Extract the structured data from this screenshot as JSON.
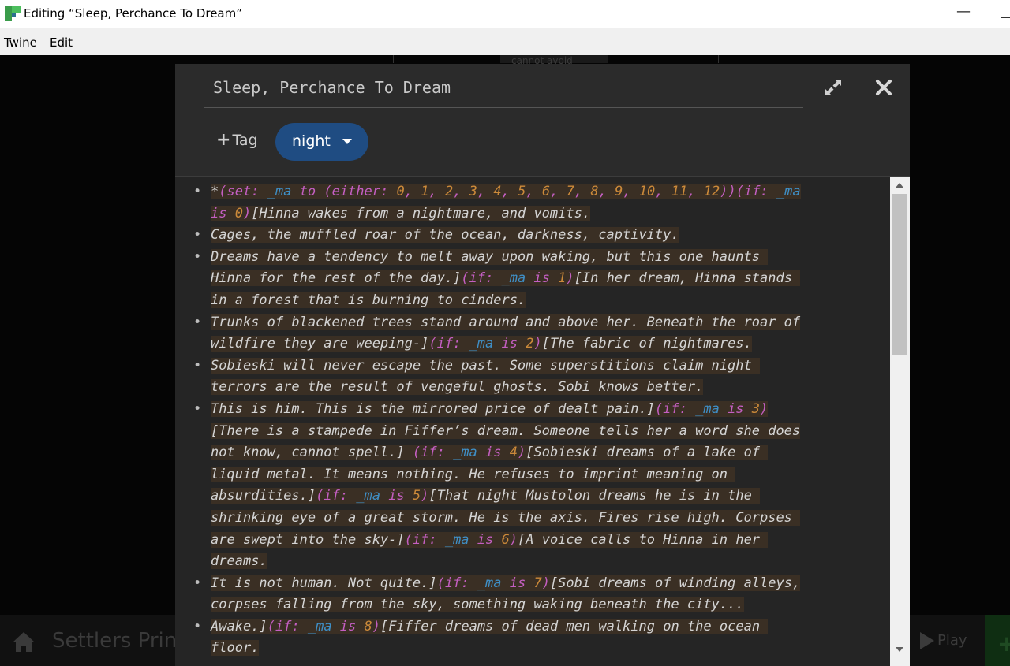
{
  "window": {
    "title": "Editing “Sleep, Perchance To Dream”",
    "menu": [
      "Twine",
      "Edit"
    ]
  },
  "background": {
    "map_label": "cannot avoid",
    "story_name": "Settlers Prin",
    "play_label": "Play"
  },
  "dialog": {
    "passage_name": "Sleep, Perchance To Dream",
    "tag_button_label": "Tag",
    "tags": [
      {
        "name": "night"
      }
    ]
  },
  "editor": {
    "lines": [
      {
        "bullet": true,
        "segments": [
          [
            "t",
            "*"
          ],
          [
            "m",
            "(set: "
          ],
          [
            "v",
            "_ma"
          ],
          [
            "m",
            " to "
          ],
          [
            "m",
            "(either: "
          ],
          [
            "n",
            "0"
          ],
          [
            "m",
            ", "
          ],
          [
            "n",
            "1"
          ],
          [
            "m",
            ", "
          ],
          [
            "n",
            "2"
          ],
          [
            "m",
            ", "
          ],
          [
            "n",
            "3"
          ],
          [
            "m",
            ", "
          ],
          [
            "n",
            "4"
          ],
          [
            "m",
            ", "
          ],
          [
            "n",
            "5"
          ],
          [
            "m",
            ", "
          ],
          [
            "n",
            "6"
          ],
          [
            "m",
            ", "
          ],
          [
            "n",
            "7"
          ],
          [
            "m",
            ", "
          ],
          [
            "n",
            "8"
          ],
          [
            "m",
            ", "
          ],
          [
            "n",
            "9"
          ],
          [
            "m",
            ", "
          ],
          [
            "n",
            "10"
          ],
          [
            "m",
            ", "
          ],
          [
            "n",
            "11"
          ],
          [
            "m",
            ", "
          ],
          [
            "n",
            "12"
          ],
          [
            "m",
            "))"
          ],
          [
            "m",
            "(if: "
          ],
          [
            "v",
            "_ma"
          ]
        ]
      },
      {
        "bullet": false,
        "segments": [
          [
            "m",
            "is "
          ],
          [
            "n",
            "0"
          ],
          [
            "m",
            ")"
          ],
          [
            "t",
            "[Hinna wakes from a nightmare, and vomits."
          ]
        ]
      },
      {
        "bullet": true,
        "segments": [
          [
            "t",
            "Cages, the muffled roar of the ocean, darkness, captivity."
          ]
        ]
      },
      {
        "bullet": true,
        "segments": [
          [
            "t",
            "Dreams have a tendency to melt away upon waking, but this one haunts "
          ]
        ]
      },
      {
        "bullet": false,
        "segments": [
          [
            "t",
            "Hinna for the rest of the day.]"
          ],
          [
            "m",
            "(if: "
          ],
          [
            "v",
            "_ma"
          ],
          [
            "m",
            " is "
          ],
          [
            "n",
            "1"
          ],
          [
            "m",
            ")"
          ],
          [
            "t",
            "[In her dream, Hinna stands "
          ]
        ]
      },
      {
        "bullet": false,
        "segments": [
          [
            "t",
            "in a forest that is burning to cinders."
          ]
        ]
      },
      {
        "bullet": true,
        "segments": [
          [
            "t",
            "Trunks of blackened trees stand around and above her. Beneath the roar of"
          ]
        ]
      },
      {
        "bullet": false,
        "segments": [
          [
            "t",
            "wildfire they are weeping-]"
          ],
          [
            "m",
            "(if: "
          ],
          [
            "v",
            "_ma"
          ],
          [
            "m",
            " is "
          ],
          [
            "n",
            "2"
          ],
          [
            "m",
            ")"
          ],
          [
            "t",
            "[The fabric of nightmares."
          ]
        ]
      },
      {
        "bullet": true,
        "segments": [
          [
            "t",
            "Sobieski will never escape the past. Some superstitions claim night "
          ]
        ]
      },
      {
        "bullet": false,
        "segments": [
          [
            "t",
            "terrors are the result of vengeful ghosts. Sobi knows better."
          ]
        ]
      },
      {
        "bullet": true,
        "segments": [
          [
            "t",
            "This is him. This is the mirrored price of dealt pain.]"
          ],
          [
            "m",
            "(if: "
          ],
          [
            "v",
            "_ma"
          ],
          [
            "m",
            " is "
          ],
          [
            "n",
            "3"
          ],
          [
            "m",
            ")"
          ]
        ]
      },
      {
        "bullet": false,
        "segments": [
          [
            "t",
            "[There is a stampede in Fiffer’s dream. Someone tells her a word she does"
          ]
        ]
      },
      {
        "bullet": false,
        "segments": [
          [
            "t",
            "not know, cannot spell.] "
          ],
          [
            "m",
            "(if: "
          ],
          [
            "v",
            "_ma"
          ],
          [
            "m",
            " is "
          ],
          [
            "n",
            "4"
          ],
          [
            "m",
            ")"
          ],
          [
            "t",
            "[Sobieski dreams of a lake of "
          ]
        ]
      },
      {
        "bullet": false,
        "segments": [
          [
            "t",
            "liquid metal. It means nothing. He refuses to imprint meaning on "
          ]
        ]
      },
      {
        "bullet": false,
        "segments": [
          [
            "t",
            "absurdities.]"
          ],
          [
            "m",
            "(if: "
          ],
          [
            "v",
            "_ma"
          ],
          [
            "m",
            " is "
          ],
          [
            "n",
            "5"
          ],
          [
            "m",
            ")"
          ],
          [
            "t",
            "[That night Mustolon dreams he is in the "
          ]
        ]
      },
      {
        "bullet": false,
        "segments": [
          [
            "t",
            "shrinking eye of a great storm. He is the axis. Fires rise high. Corpses "
          ]
        ]
      },
      {
        "bullet": false,
        "segments": [
          [
            "t",
            "are swept into the sky-]"
          ],
          [
            "m",
            "(if: "
          ],
          [
            "v",
            "_ma"
          ],
          [
            "m",
            " is "
          ],
          [
            "n",
            "6"
          ],
          [
            "m",
            ")"
          ],
          [
            "t",
            "[A voice calls to Hinna in her "
          ]
        ]
      },
      {
        "bullet": false,
        "segments": [
          [
            "t",
            "dreams."
          ]
        ]
      },
      {
        "bullet": true,
        "segments": [
          [
            "t",
            "It is not human. Not quite.]"
          ],
          [
            "m",
            "(if: "
          ],
          [
            "v",
            "_ma"
          ],
          [
            "m",
            " is "
          ],
          [
            "n",
            "7"
          ],
          [
            "m",
            ")"
          ],
          [
            "t",
            "[Sobi dreams of winding alleys,"
          ]
        ]
      },
      {
        "bullet": false,
        "segments": [
          [
            "t",
            "corpses falling from the sky, something waking beneath the city..."
          ]
        ]
      },
      {
        "bullet": true,
        "segments": [
          [
            "t",
            "Awake.]"
          ],
          [
            "m",
            "(if: "
          ],
          [
            "v",
            "_ma"
          ],
          [
            "m",
            " is "
          ],
          [
            "n",
            "8"
          ],
          [
            "m",
            ")"
          ],
          [
            "t",
            "[Fiffer dreams of dead men walking on the ocean "
          ]
        ]
      },
      {
        "bullet": false,
        "segments": [
          [
            "t",
            "floor."
          ]
        ]
      }
    ]
  },
  "colors": {
    "macro": "#c45fc2",
    "variable": "#3f8fc6",
    "number": "#cc8a3a",
    "text": "#d4d4d4",
    "tag_chip": "#1f4c82",
    "highlight": "#3a2f24"
  },
  "icons": {
    "app": "twine-logo-icon",
    "expand": "expand-icon",
    "close": "close-icon",
    "add_tag": "plus-icon",
    "tag_dropdown": "caret-down-icon",
    "home": "home-icon",
    "play": "play-icon"
  }
}
